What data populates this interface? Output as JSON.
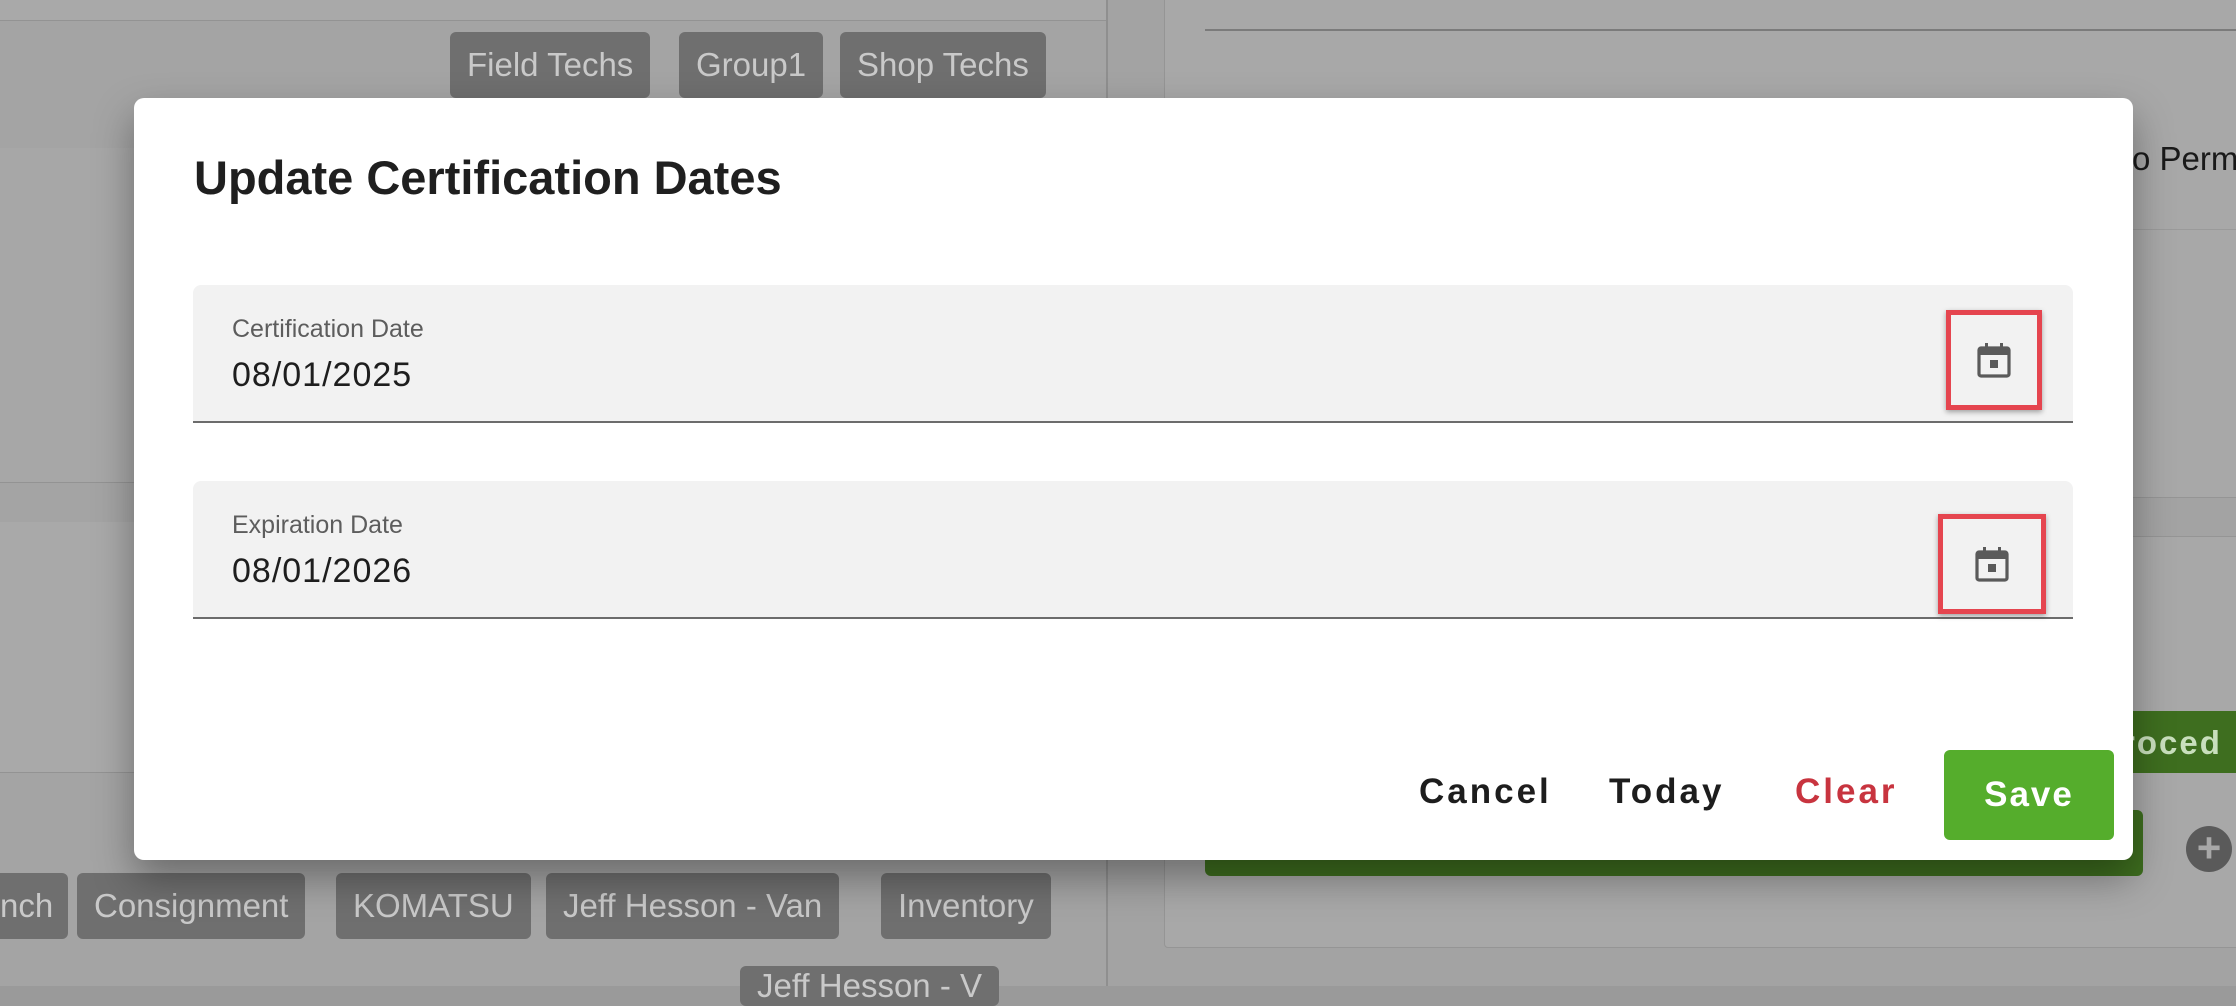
{
  "background": {
    "top_chips": [
      "Field Techs",
      "Group1",
      "Shop Techs"
    ],
    "bottom_chips": [
      "nch",
      "Consignment",
      "KOMATSU",
      "Jeff Hesson - Van",
      "Inventory"
    ],
    "partial_chip": "Jeff Hesson - V",
    "right_partial_text": "o Perm",
    "right_green_text": "roced"
  },
  "dialog": {
    "title": "Update Certification Dates",
    "fields": [
      {
        "label": "Certification Date",
        "value": "08/01/2025",
        "icon": "calendar-icon"
      },
      {
        "label": "Expiration Date",
        "value": "08/01/2026",
        "icon": "calendar-icon"
      }
    ],
    "actions": {
      "cancel": "Cancel",
      "today": "Today",
      "clear": "Clear",
      "save": "Save"
    }
  },
  "colors": {
    "save": "#55ad2c",
    "clear": "#c8343f",
    "highlight": "#e5454f"
  }
}
